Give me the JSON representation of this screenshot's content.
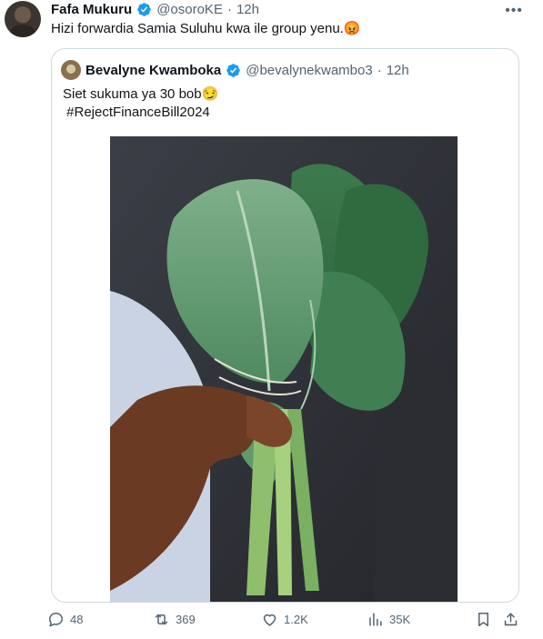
{
  "tweet": {
    "author_name": "Fafa Mukuru",
    "author_handle": "@osoroKE",
    "separator": "·",
    "time": "12h",
    "text": "Hizi forwardia Samia Suluhu kwa ile group yenu.😡"
  },
  "quote": {
    "author_name": "Bevalyne Kwamboka",
    "author_handle": "@bevalynekwambo3",
    "separator": "·",
    "time": "12h",
    "text_line1": "Siet sukuma ya 30 bob😏",
    "text_line2": " #RejectFinanceBill2024"
  },
  "actions": {
    "replies": "48",
    "reposts": "369",
    "likes": "1.2K",
    "views": "35K"
  },
  "colors": {
    "verified": "#1d9bf0",
    "muted": "#536471",
    "border": "#cfd9de"
  }
}
